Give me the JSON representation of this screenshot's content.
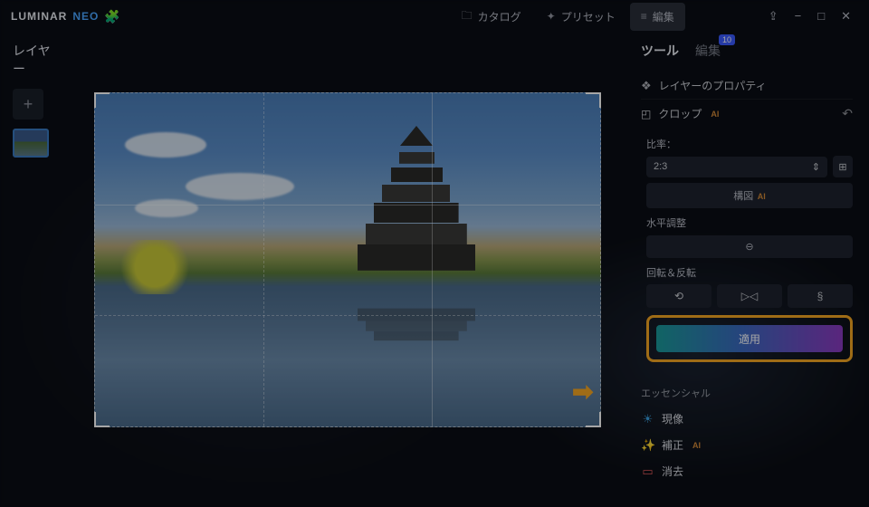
{
  "app": {
    "brand": "LUMINAR",
    "brand_suffix": "NEO"
  },
  "nav": {
    "catalog": "カタログ",
    "presets": "プリセット",
    "edit": "編集"
  },
  "left": {
    "title": "レイヤー"
  },
  "right": {
    "tabs": {
      "tools": "ツール",
      "edit": "編集",
      "badge": "10"
    },
    "layer_props": "レイヤーのプロパティ",
    "crop": {
      "title": "クロップ",
      "ratio_label": "比率：",
      "ratio_value": "2:3",
      "composition": "構図",
      "horizon": "水平調整",
      "rotate_flip": "回転＆反転",
      "apply": "適用"
    },
    "essentials": {
      "title": "エッセンシャル",
      "develop": "現像",
      "enhance": "補正",
      "erase": "消去"
    }
  }
}
